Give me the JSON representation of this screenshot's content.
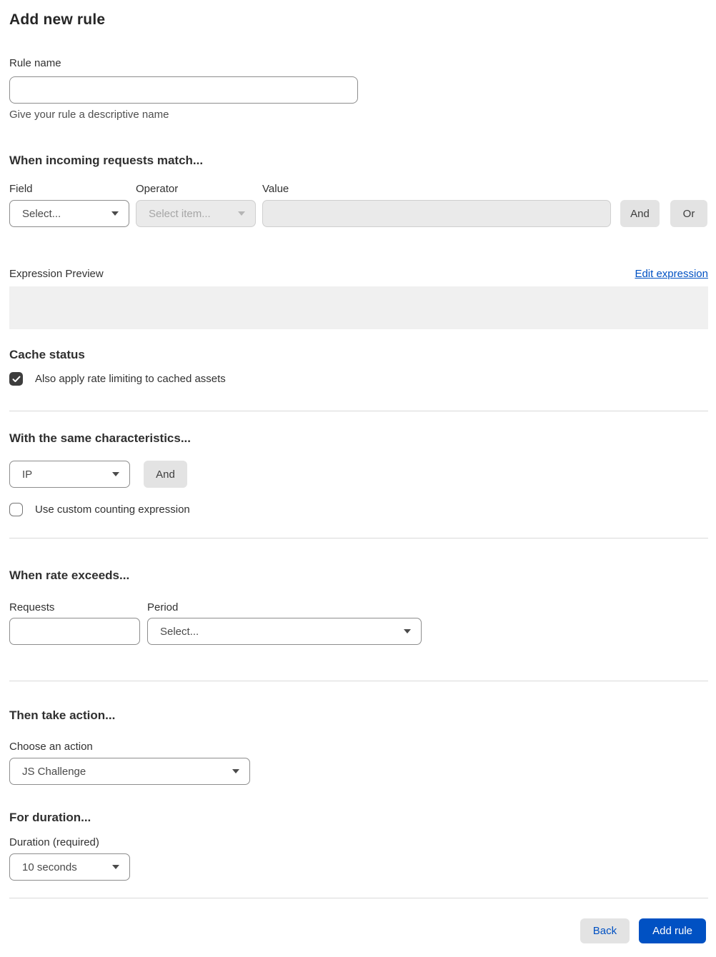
{
  "page": {
    "title": "Add new rule"
  },
  "rule_name": {
    "label": "Rule name",
    "value": "",
    "helper": "Give your rule a descriptive name"
  },
  "match_section": {
    "heading": "When incoming requests match...",
    "field": {
      "label": "Field",
      "selected": "Select..."
    },
    "operator": {
      "label": "Operator",
      "selected": "Select item...",
      "disabled": true
    },
    "value": {
      "label": "Value",
      "value": "",
      "disabled": true
    },
    "and_button": "And",
    "or_button": "Or",
    "expression_preview_label": "Expression Preview",
    "edit_expression_link": "Edit expression",
    "expression_value": ""
  },
  "cache_status": {
    "heading": "Cache status",
    "checkbox_label": "Also apply rate limiting to cached assets",
    "checked": true
  },
  "characteristics_section": {
    "heading": "With the same characteristics...",
    "characteristic_selected": "IP",
    "and_button": "And",
    "custom_counting_label": "Use custom counting expression",
    "custom_counting_checked": false
  },
  "rate_section": {
    "heading": "When rate exceeds...",
    "requests": {
      "label": "Requests",
      "value": ""
    },
    "period": {
      "label": "Period",
      "selected": "Select..."
    }
  },
  "action_section": {
    "heading": "Then take action...",
    "choose_label": "Choose an action",
    "selected": "JS Challenge"
  },
  "duration_section": {
    "heading": "For duration...",
    "label": "Duration (required)",
    "selected": "10 seconds"
  },
  "footer": {
    "back_label": "Back",
    "add_rule_label": "Add rule"
  },
  "colors": {
    "accent_blue": "#0051c3",
    "button_gray": "#e3e3e3",
    "disabled_bg": "#eaeaea",
    "preview_bg": "#f0f0f0",
    "checkbox_checked": "#3d3d3d",
    "divider": "#d9d9d9"
  },
  "icons": {
    "chevron_down": "triangle-down",
    "check": "checkmark"
  }
}
